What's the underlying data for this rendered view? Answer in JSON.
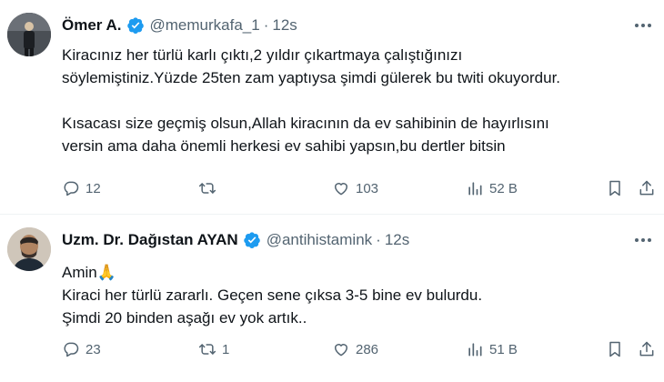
{
  "tweets": [
    {
      "author": "Ömer A.",
      "handle": "@memurkafa_1",
      "time": "12s",
      "lines": [
        "Kiracınız her türlü karlı çıktı,2 yıldır çıkartmaya çalıştığınızı",
        "söylemiştiniz.Yüzde 25ten zam yaptıysa şimdi gülerek bu twiti okuyordur.",
        "Kısacası size geçmiş olsun,Allah kiracının da ev sahibinin de hayırlısını",
        "versin ama daha önemli herkesi ev sahibi yapsın,bu dertler bitsin"
      ],
      "replies": "12",
      "retweets": "",
      "likes": "103",
      "views": "52 B"
    },
    {
      "author": "Uzm. Dr. Dağıstan AYAN",
      "handle": "@antihistamink",
      "time": "12s",
      "lines": [
        "Amin",
        "Kiraci her türlü zararlı. Geçen sene çıksa 3-5 bine ev bulurdu.",
        "Şimdi 20 binden aşağı ev yok artık.."
      ],
      "emoji": "🙏",
      "replies": "23",
      "retweets": "1",
      "likes": "286",
      "views": "51 B"
    }
  ],
  "colors": {
    "text": "#0f1419",
    "muted": "#536471",
    "verified": "#1d9bf0",
    "divider": "#eff3f4"
  },
  "icons": [
    "verified-badge-icon",
    "more-icon",
    "reply-icon",
    "retweet-icon",
    "like-icon",
    "views-icon",
    "bookmark-icon",
    "share-icon"
  ]
}
